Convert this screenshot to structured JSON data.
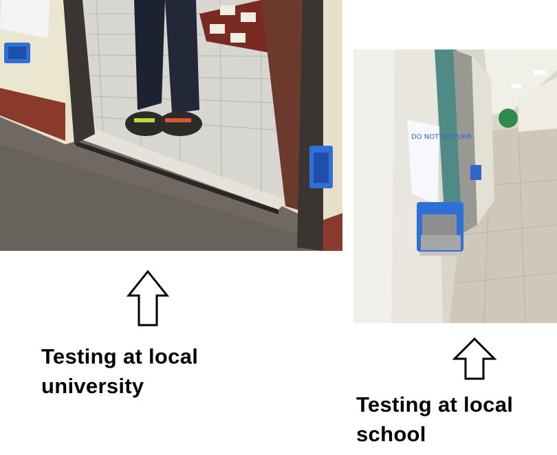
{
  "captions": {
    "university": {
      "line1": "Testing at local",
      "line2": "university"
    },
    "school": {
      "line1": "Testing at local",
      "line2": "school"
    }
  },
  "photos": {
    "university_sign_text": "",
    "school_sign_text": "DO NOT DISTURB"
  },
  "icons": {
    "arrow_university": "up-arrow-outline-icon",
    "arrow_school": "up-arrow-outline-icon"
  },
  "colors": {
    "background": "#ffffff",
    "caption_text": "#000000",
    "sensor_blue": "#2f6fd6",
    "carpet": "#6f6863",
    "door_frame": "#3a3530",
    "floor_tile": "#d8d6d0",
    "hall_wall": "#e9e6df",
    "hall_door_teal": "#4f8a85"
  }
}
